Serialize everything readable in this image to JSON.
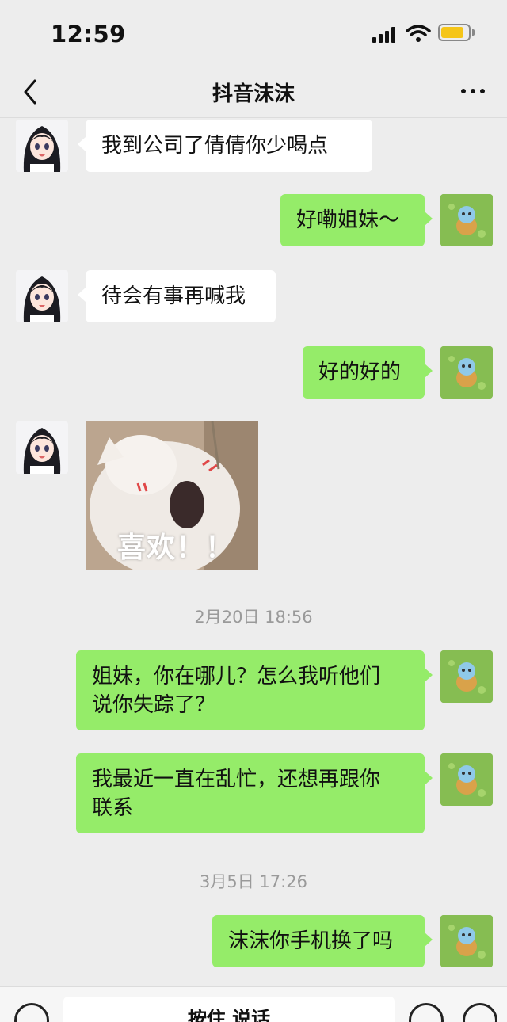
{
  "status_bar": {
    "time": "12:59",
    "battery_color": "#f5c518"
  },
  "nav": {
    "title": "抖音沫沫",
    "back_icon": "chevron-left-icon",
    "more_icon": "more-dots-icon"
  },
  "colors": {
    "incoming_bubble": "#ffffff",
    "outgoing_bubble": "#95ec69",
    "background": "#ededed",
    "timestamp": "#9a9a9a"
  },
  "messages": [
    {
      "side": "in",
      "text": "我到公司了倩倩你少喝点"
    },
    {
      "side": "out",
      "text": "好嘞姐妹～"
    },
    {
      "side": "in",
      "text": "待会有事再喊我"
    },
    {
      "side": "out",
      "text": "好的好的"
    },
    {
      "side": "in",
      "type": "sticker",
      "text": "喜欢！！"
    },
    {
      "type": "timestamp",
      "text": "2月20日 18:56"
    },
    {
      "side": "out",
      "text": "姐妹，你在哪儿？怎么我听他们\n说你失踪了？"
    },
    {
      "side": "out",
      "text": "我最近一直在乱忙，还想再跟你\n联系"
    },
    {
      "type": "timestamp",
      "text": "3月5日 17:26"
    },
    {
      "side": "out",
      "text": "沫沫你手机换了吗"
    }
  ],
  "input_bar": {
    "hold_to_talk": "按住 说话",
    "voice_icon": "keyboard-voice-icon",
    "emoji_icon": "emoji-icon",
    "plus_icon": "plus-icon"
  }
}
